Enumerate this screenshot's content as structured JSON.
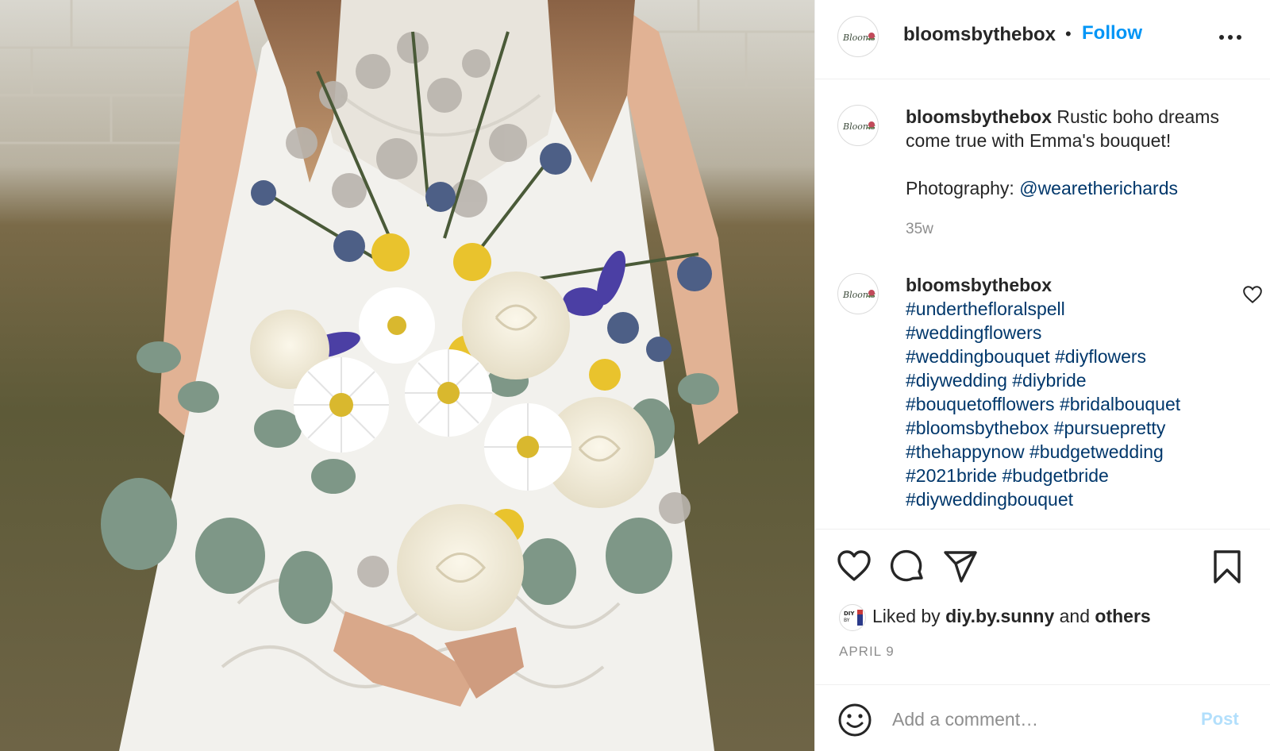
{
  "header": {
    "username": "bloomsbythebox",
    "separator": "•",
    "follow_label": "Follow",
    "more_icon": "more-horizontal-icon"
  },
  "caption": {
    "username": "bloomsbythebox",
    "text_line1": "Rustic boho dreams come true with Emma's bouquet!",
    "photo_label": "Photography:",
    "photo_mention": "@wearetherichards",
    "time_ago": "35w"
  },
  "comment": {
    "username": "bloomsbythebox",
    "hashtags": [
      "#underthefloralspell",
      "#weddingflowers",
      "#weddingbouquet",
      "#diyflowers",
      "#diywedding",
      "#diybride",
      "#bouquetofflowers",
      "#bridalbouquet",
      "#bloomsbythebox",
      "#pursuepretty",
      "#thehappynow",
      "#budgetwedding",
      "#2021bride",
      "#budgetbride",
      "#diyweddingbouquet"
    ]
  },
  "actions": {
    "icons": [
      "heart-icon",
      "comment-icon",
      "share-icon",
      "bookmark-icon"
    ],
    "liked_prefix": "Liked by",
    "liked_user": "diy.by.sunny",
    "liked_and": "and",
    "liked_others": "others",
    "date": "APRIL 9"
  },
  "add_comment": {
    "placeholder": "Add a comment…",
    "post_label": "Post"
  },
  "colors": {
    "accent": "#0095f6",
    "link": "#00376b",
    "muted": "#8e8e8e",
    "post_disabled": "#b2dffc",
    "border": "#efefef"
  }
}
